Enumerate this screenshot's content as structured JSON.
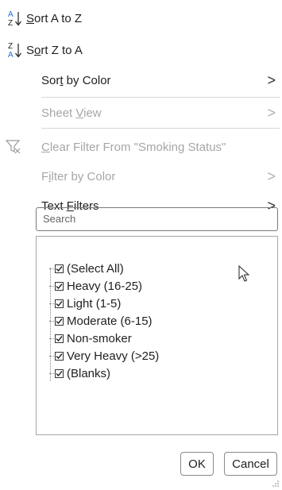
{
  "menu": {
    "sort_az": {
      "pre": "",
      "u": "S",
      "post": "ort A to Z"
    },
    "sort_za": {
      "pre": "S",
      "u": "o",
      "post": "rt Z to A"
    },
    "sort_by_color": {
      "pre": "Sor",
      "u": "t",
      "post": " by Color"
    },
    "sheet_view": {
      "pre": "Sheet ",
      "u": "V",
      "post": "iew"
    },
    "clear_filter": {
      "pre": "",
      "u": "C",
      "post": "lear Filter From \"Smoking Status\""
    },
    "filter_by_color": {
      "pre": "F",
      "u": "i",
      "post": "lter by Color"
    },
    "text_filters": {
      "pre": "Text ",
      "u": "F",
      "post": "ilters"
    },
    "chevron": ">"
  },
  "search": {
    "placeholder": "Search"
  },
  "list": {
    "items": [
      {
        "label": "(Select All)",
        "checked": true
      },
      {
        "label": "Heavy (16-25)",
        "checked": true
      },
      {
        "label": "Light (1-5)",
        "checked": true
      },
      {
        "label": "Moderate (6-15)",
        "checked": true
      },
      {
        "label": "Non-smoker",
        "checked": true
      },
      {
        "label": "Very Heavy (>25)",
        "checked": true
      },
      {
        "label": "(Blanks)",
        "checked": true
      }
    ]
  },
  "buttons": {
    "ok": "OK",
    "cancel": "Cancel"
  },
  "colors": {
    "accent": "#1f6fd1",
    "disabled": "#a6a6a6"
  }
}
